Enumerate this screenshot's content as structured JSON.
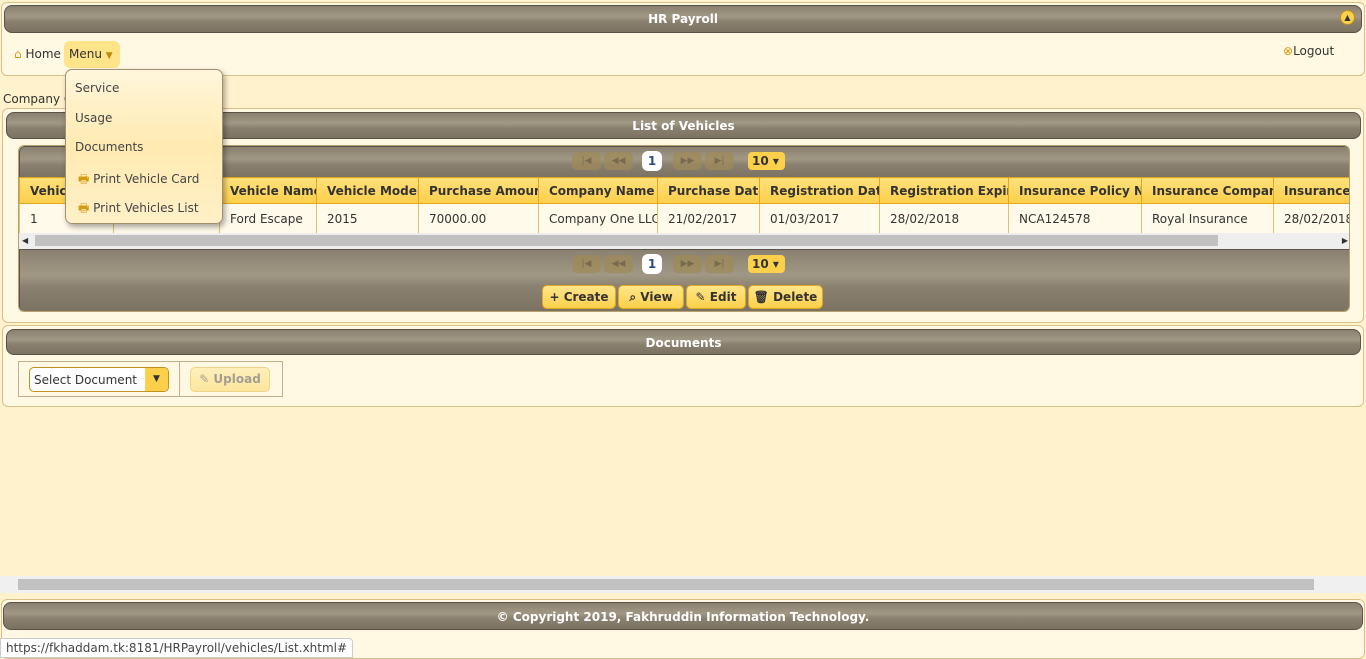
{
  "header": {
    "title": "HR Payroll",
    "home": "Home",
    "menu": "Menu",
    "logout": "Logout"
  },
  "menu_items": [
    {
      "label": "Service",
      "icon": ""
    },
    {
      "label": "Usage",
      "icon": ""
    },
    {
      "label": "Documents",
      "icon": ""
    },
    {
      "label": "Print Vehicle Card",
      "icon": "print-icon"
    },
    {
      "label": "Print Vehicles List",
      "icon": "print-icon"
    }
  ],
  "company_label": "Company C",
  "vehicles": {
    "title": "List of Vehicles",
    "page": "1",
    "rows_per_page": "10",
    "columns": [
      "Vehicle",
      "",
      "Vehicle Name",
      "Vehicle Model",
      "Purchase Amount",
      "Company Name",
      "Purchase Date",
      "Registration Date",
      "Registration Expiry",
      "Insurance Policy No",
      "Insurance Company",
      "Insurance E"
    ],
    "rows": [
      [
        "1",
        "",
        "Ford Escape",
        "2015",
        "70000.00",
        "Company One LLC",
        "21/02/2017",
        "01/03/2017",
        "28/02/2018",
        "NCA124578",
        "Royal Insurance",
        "28/02/2018"
      ]
    ],
    "buttons": {
      "create": "Create",
      "view": "View",
      "edit": "Edit",
      "delete": "Delete"
    }
  },
  "documents": {
    "title": "Documents",
    "select_placeholder": "Select Document",
    "upload": "Upload"
  },
  "footer": {
    "copyright": "© Copyright 2019, Fakhruddin Information Technology."
  },
  "status_url": "https://fkhaddam.tk:8181/HRPayroll/vehicles/List.xhtml#",
  "colors": {
    "accent": "#fcd04a",
    "bar": "#9a917e",
    "background": "#fff2cc"
  }
}
